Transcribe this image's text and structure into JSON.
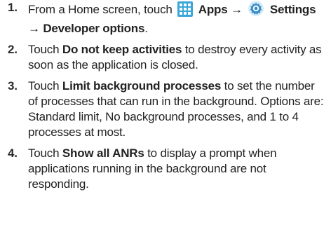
{
  "steps": [
    {
      "number": "1.",
      "text_a": "From a Home screen, touch ",
      "icon_1": "apps-grid-icon",
      "label_apps": "Apps",
      "arrow_1": "→",
      "icon_2": "settings-gear-icon",
      "label_settings": "Settings",
      "arrow_2": "→",
      "label_developer": "Developer options",
      "text_end": "."
    },
    {
      "number": "2.",
      "text_a": "Touch ",
      "bold": "Do not keep activities",
      "text_b": " to destroy every activity as soon as the application is closed."
    },
    {
      "number": "3.",
      "text_a": "Touch ",
      "bold": "Limit background processes",
      "text_b": " to set the number of processes that can run in the background. Options are: Standard limit, No background processes, and 1 to 4 processes at most."
    },
    {
      "number": "4.",
      "text_a": "Touch ",
      "bold": "Show all ANRs",
      "text_b": " to display a prompt when applications running in the background are not responding."
    }
  ],
  "colors": {
    "apps_icon": "#3aa7d8",
    "settings_icon": "#3a8fc8"
  }
}
